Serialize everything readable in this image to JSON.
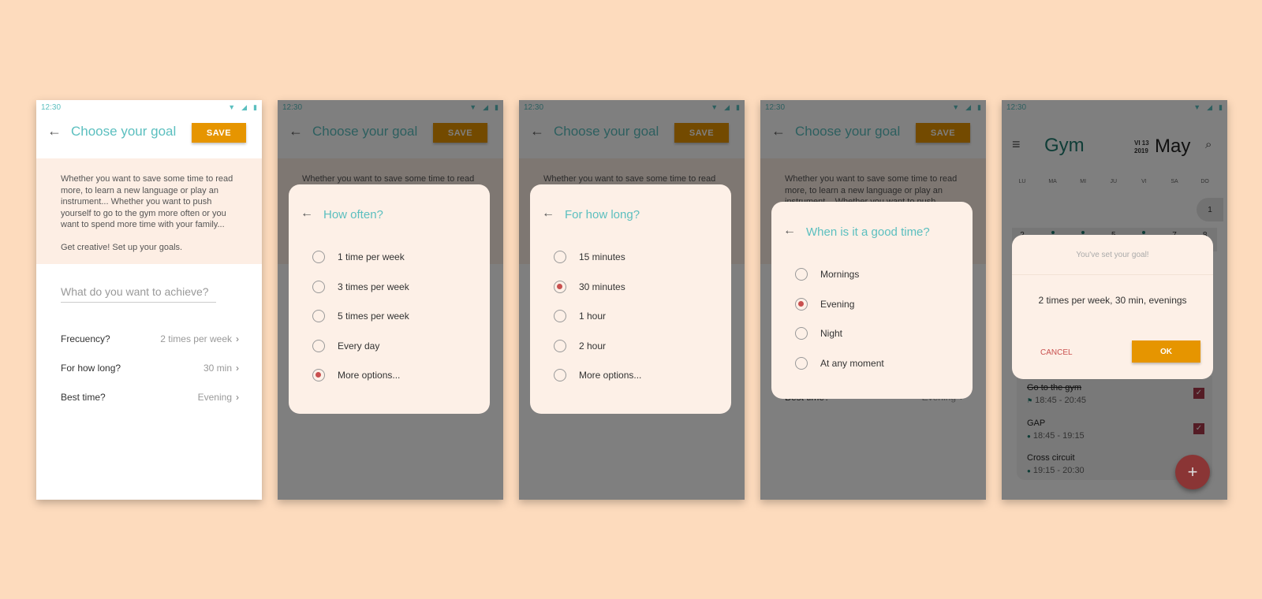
{
  "status": {
    "time": "12:30",
    "icons": [
      "wifi-icon",
      "signal-icon",
      "battery-icon"
    ]
  },
  "goal": {
    "title": "Choose your goal",
    "save_label": "SAVE",
    "intro": "Whether you want to save some time to read more, to learn a new language or play an instrument... Whether you want to push yourself to go to the gym more often or you want to spend more time with your family...",
    "intro2": "Get creative! Set up your goals.",
    "input_placeholder": "What do you want to achieve?",
    "rows": [
      {
        "label": "Frecuency?",
        "value": "2 times per week"
      },
      {
        "label": "For how long?",
        "value": "30 min"
      },
      {
        "label": "Best time?",
        "value": "Evening"
      }
    ]
  },
  "dialogs": [
    {
      "title": "How often?",
      "selected": 4,
      "options": [
        "1 time per week",
        "3 times per week",
        "5 times per week",
        "Every day",
        "More options..."
      ]
    },
    {
      "title": "For how long?",
      "selected": 1,
      "options": [
        "15 minutes",
        "30 minutes",
        "1 hour",
        "2 hour",
        "More options..."
      ]
    },
    {
      "title": "When is it a good time?",
      "selected": 1,
      "options": [
        "Mornings",
        "Evening",
        "Night",
        "At any moment"
      ]
    }
  ],
  "calendar": {
    "title": "Gym",
    "day": "VI 13",
    "year": "2019",
    "month": "May",
    "weekdays": [
      "LU",
      "MA",
      "MI",
      "JU",
      "VI",
      "SA",
      "DO"
    ],
    "week1": [
      "1"
    ],
    "week2": [
      "2",
      "3",
      "4",
      "5",
      "6",
      "7",
      "8"
    ],
    "tasks": [
      {
        "name": "Go to the gym",
        "time": "18:45 - 20:45",
        "done": true
      },
      {
        "name": "GAP",
        "time": "18:45 - 19:15",
        "done": true
      },
      {
        "name": "Cross circuit",
        "time": "19:15 - 20:30",
        "done": false
      }
    ],
    "confirm": {
      "title": "You've set your goal!",
      "message": "2 times per week, 30 min, evenings",
      "cancel": "CANCEL",
      "ok": "OK"
    }
  },
  "colors": {
    "background": "#fddbbd",
    "accent": "#5bbfbf",
    "button": "#e69500",
    "radio": "#c9504f",
    "calendar_title": "#1e7a6e",
    "fab": "#a53a3a"
  }
}
